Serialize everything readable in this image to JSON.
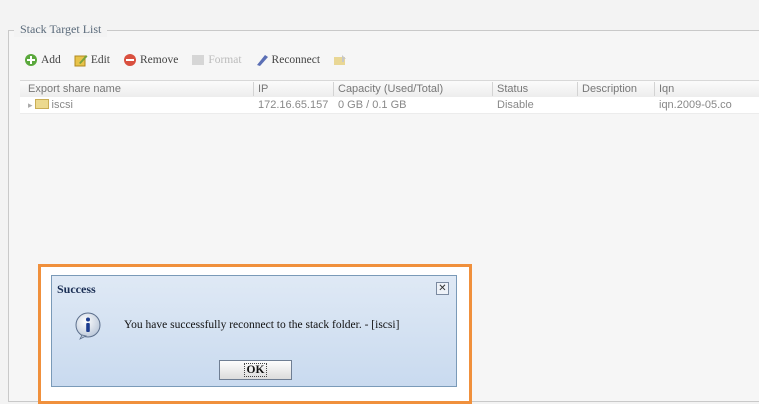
{
  "panel": {
    "legend": "Stack Target List"
  },
  "toolbar": {
    "add": "Add",
    "edit": "Edit",
    "remove": "Remove",
    "format": "Format",
    "reconnect": "Reconnect",
    "extra": ""
  },
  "table": {
    "headers": [
      "Export share name",
      "IP",
      "Capacity (Used/Total)",
      "Status",
      "Description",
      "Iqn"
    ],
    "rows": [
      [
        "iscsi",
        "172.16.65.157",
        "0 GB / 0.1 GB",
        "Disable",
        "",
        "iqn.2009-05.co"
      ]
    ]
  },
  "dialog": {
    "title": "Success",
    "close": "✕",
    "message": "You have successfully reconnect to the stack folder. - [iscsi]",
    "ok": "OK"
  },
  "colors": {
    "highlight": "#f0903c",
    "dialog_bg": "#d6e3f2"
  }
}
